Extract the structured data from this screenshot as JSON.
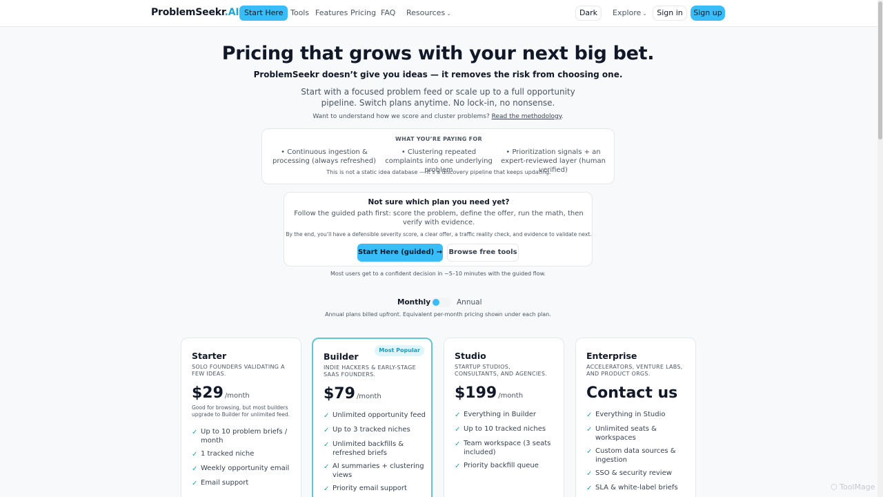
{
  "nav": {
    "logo_main": "ProblemSeekr",
    "logo_suffix": ".AI",
    "start_here": "Start Here",
    "links": [
      "Tools",
      "Features",
      "Pricing",
      "FAQ",
      "Resources"
    ],
    "theme_toggle": "Dark",
    "explore": "Explore",
    "sign_in": "Sign in",
    "sign_up": "Sign up"
  },
  "hero": {
    "title": "Pricing that grows with your next big bet.",
    "subtitle": "ProblemSeekr doesn’t give you ideas — it removes the risk from choosing one.",
    "description": "Start with a focused problem feed or scale up to a full opportunity pipeline. Switch plans anytime. No lock-in, no nonsense.",
    "methodology_prefix": "Want to understand how we score and cluster problems?",
    "methodology_link": "Read the methodology",
    "methodology_suffix": "."
  },
  "paying": {
    "heading": "WHAT YOU’RE PAYING FOR",
    "items": [
      "• Continuous ingestion & processing (always refreshed)",
      "• Clustering repeated complaints into one underlying problem",
      "• Prioritization signals + an expert-reviewed layer (human verified)"
    ],
    "note": "This is not a static idea database — it’s a discovery pipeline that keeps updating."
  },
  "guided": {
    "title": "Not sure which plan you need yet?",
    "description": "Follow the guided path first: score the problem, define the offer, run the math, then verify with evidence.",
    "note": "By the end, you’ll have a defensible severity score, a clear offer, a traffic reality check, and evidence to validate next.",
    "primary_button": "Start Here (guided) →",
    "secondary_button": "Browse free tools",
    "after_note": "Most users get to a confident decision in ~5–10 minutes with the guided flow."
  },
  "billing": {
    "monthly": "Monthly",
    "annual": "Annual",
    "selected": "Monthly",
    "note": "Annual plans billed upfront. Equivalent per-month pricing shown under each plan."
  },
  "plans": [
    {
      "name": "Starter",
      "audience": "SOLO FOUNDERS VALIDATING A FEW IDEAS.",
      "price": "$29",
      "period": "/month",
      "price_note": "Good for browsing, but most builders upgrade to Builder for unlimited feed.",
      "features": [
        "Up to 10 problem briefs / month",
        "1 tracked niche",
        "Weekly opportunity email",
        "Email support"
      ]
    },
    {
      "name": "Builder",
      "badge": "Most Popular",
      "audience": "INDIE HACKERS & EARLY-STAGE SAAS FOUNDERS.",
      "price": "$79",
      "period": "/month",
      "features": [
        "Unlimited opportunity feed",
        "Up to 3 tracked niches",
        "Unlimited backfills & refreshed briefs",
        "AI summaries + clustering views",
        "Priority email support"
      ]
    },
    {
      "name": "Studio",
      "audience": "STARTUP STUDIOS, CONSULTANTS, AND AGENCIES.",
      "price": "$199",
      "period": "/month",
      "features": [
        "Everything in Builder",
        "Up to 10 tracked niches",
        "Team workspace (3 seats included)",
        "Priority backfill queue"
      ]
    },
    {
      "name": "Enterprise",
      "audience": "ACCELERATORS, VENTURE LABS, AND PRODUCT ORGS.",
      "price": "Contact us",
      "features": [
        "Everything in Studio",
        "Unlimited seats & workspaces",
        "Custom data sources & ingestion",
        "SSO & security review",
        "SLA & white-label briefs"
      ]
    }
  ],
  "watermark": "ToolMage",
  "colors": {
    "accent": "#38bdf8",
    "popular_border": "#5ec6d6",
    "check": "#1aa6a6"
  }
}
